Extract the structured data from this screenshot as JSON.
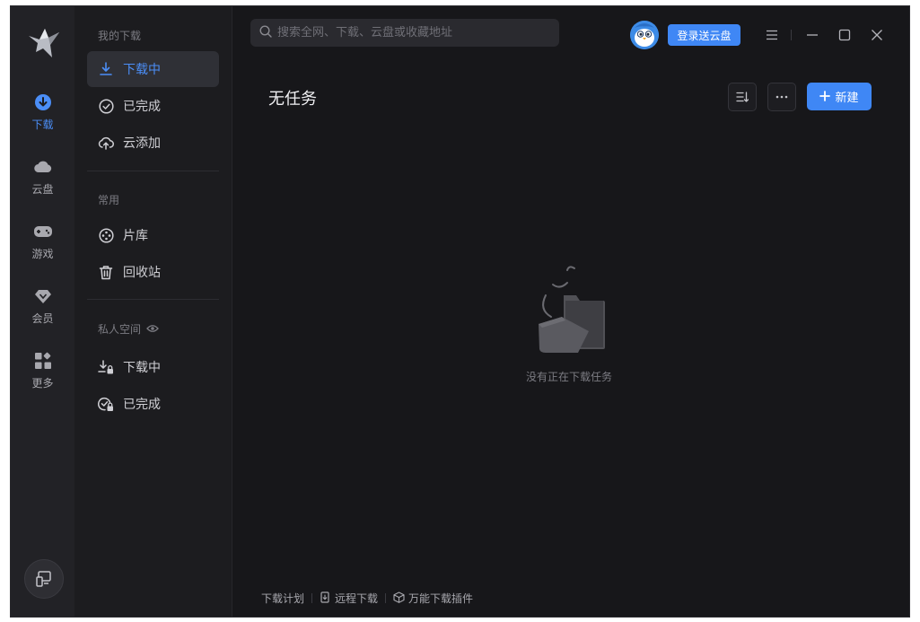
{
  "rail": {
    "items": [
      {
        "label": "下载",
        "icon": "download-circle-icon",
        "active": true
      },
      {
        "label": "云盘",
        "icon": "cloud-icon"
      },
      {
        "label": "游戏",
        "icon": "gamepad-icon"
      },
      {
        "label": "会员",
        "icon": "diamond-icon"
      },
      {
        "label": "更多",
        "icon": "grid-icon"
      }
    ],
    "bottom_icon": "device-icon"
  },
  "nav": {
    "section_downloads": "我的下载",
    "downloads": [
      {
        "label": "下载中",
        "icon": "download-arrow-icon",
        "active": true
      },
      {
        "label": "已完成",
        "icon": "check-circle-icon"
      },
      {
        "label": "云添加",
        "icon": "cloud-upload-icon"
      }
    ],
    "section_common": "常用",
    "common": [
      {
        "label": "片库",
        "icon": "film-reel-icon"
      },
      {
        "label": "回收站",
        "icon": "trash-icon"
      }
    ],
    "section_private": "私人空间",
    "private": [
      {
        "label": "下载中",
        "icon": "download-lock-icon"
      },
      {
        "label": "已完成",
        "icon": "check-lock-icon"
      }
    ]
  },
  "header": {
    "search_placeholder": "搜索全网、下载、云盘或收藏地址",
    "login_label": "登录送云盘"
  },
  "main": {
    "title": "无任务",
    "new_label": "新建",
    "empty_text": "没有正在下载任务"
  },
  "footer": {
    "links": [
      "下载计划",
      "远程下载",
      "万能下载插件"
    ]
  },
  "colors": {
    "accent": "#3f87f5",
    "background": "#17171a",
    "rail": "#222226",
    "nav": "#1c1c1f"
  }
}
